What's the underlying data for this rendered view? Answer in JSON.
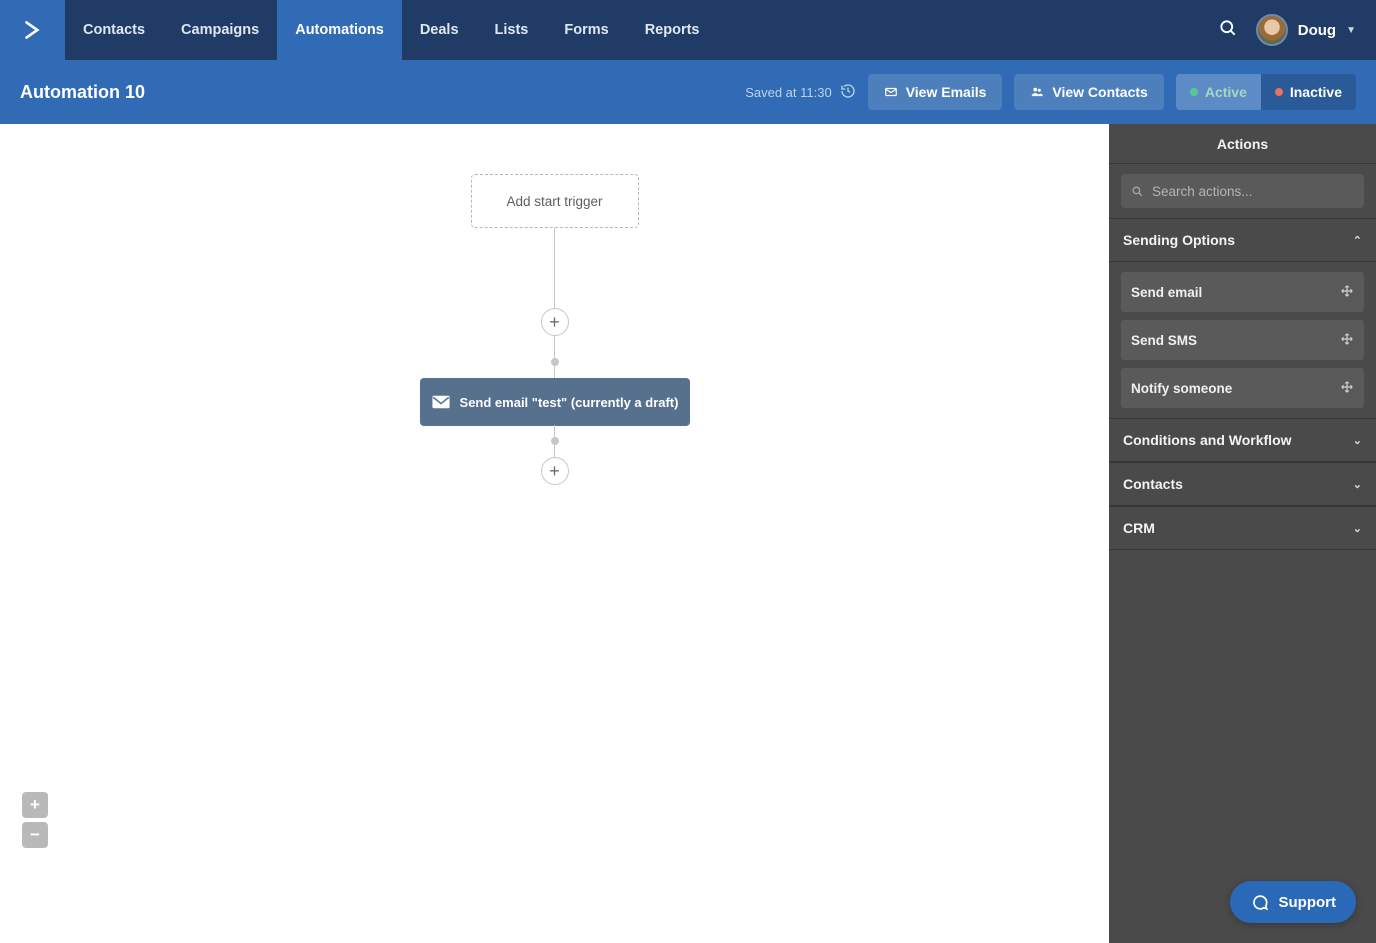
{
  "nav": {
    "items": [
      "Contacts",
      "Campaigns",
      "Automations",
      "Deals",
      "Lists",
      "Forms",
      "Reports"
    ],
    "active_index": 2
  },
  "user": {
    "name": "Doug"
  },
  "subheader": {
    "title": "Automation 10",
    "saved_text": "Saved at 11:30",
    "view_emails_label": "View Emails",
    "view_contacts_label": "View Contacts",
    "status_active_label": "Active",
    "status_inactive_label": "Inactive"
  },
  "canvas": {
    "start_trigger_label": "Add start trigger",
    "action_block_label": "Send email \"test\" (currently a draft)"
  },
  "zoom": {
    "in_label": "+",
    "out_label": "−"
  },
  "panel": {
    "header": "Actions",
    "search_placeholder": "Search actions...",
    "sections": [
      {
        "title": "Sending Options",
        "expanded": true,
        "items": [
          "Send email",
          "Send SMS",
          "Notify someone"
        ]
      },
      {
        "title": "Conditions and Workflow",
        "expanded": false
      },
      {
        "title": "Contacts",
        "expanded": false
      },
      {
        "title": "CRM",
        "expanded": false
      }
    ]
  },
  "support_label": "Support"
}
